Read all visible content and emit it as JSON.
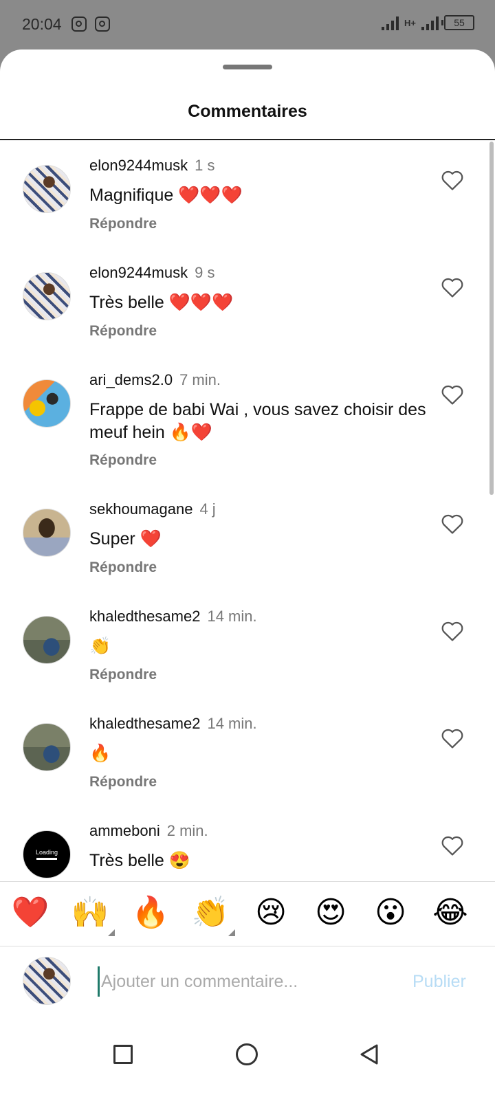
{
  "status_bar": {
    "time": "20:04",
    "network": "H+",
    "battery": "55"
  },
  "sheet": {
    "title": "Commentaires"
  },
  "comments": [
    {
      "username": "elon9244musk",
      "time": "1 s",
      "text": "Magnifique ❤️❤️❤️",
      "reply_label": "Répondre",
      "avatar": "user-photo"
    },
    {
      "username": "elon9244musk",
      "time": "9 s",
      "text": "Très belle ❤️❤️❤️",
      "reply_label": "Répondre",
      "avatar": "user-photo"
    },
    {
      "username": "ari_dems2.0",
      "time": "7 min.",
      "text": "Frappe de babi Wai , vous savez choisir des meuf hein 🔥❤️",
      "reply_label": "Répondre",
      "avatar": "user-photo"
    },
    {
      "username": "sekhoumagane",
      "time": "4 j",
      "text": "Super ❤️",
      "reply_label": "Répondre",
      "avatar": "user-photo"
    },
    {
      "username": "khaledthesame2",
      "time": "14 min.",
      "text": "👏",
      "reply_label": "Répondre",
      "avatar": "user-photo"
    },
    {
      "username": "khaledthesame2",
      "time": "14 min.",
      "text": "🔥",
      "reply_label": "Répondre",
      "avatar": "user-photo"
    },
    {
      "username": "ammeboni",
      "time": "2 min.",
      "text": "Très belle 😍",
      "reply_label": "",
      "avatar": "loading-avatar",
      "avatar_text": "Loading"
    }
  ],
  "quick_emojis": [
    "❤️",
    "🙌",
    "🔥",
    "👏",
    "😢",
    "😍",
    "😮",
    "😂"
  ],
  "input": {
    "placeholder": "Ajouter un commentaire...",
    "value": "",
    "publish_label": "Publier"
  },
  "colors": {
    "publish_disabled": "#b7dcf5",
    "caret": "#1f7a6a",
    "heart_outline": "#555555"
  }
}
